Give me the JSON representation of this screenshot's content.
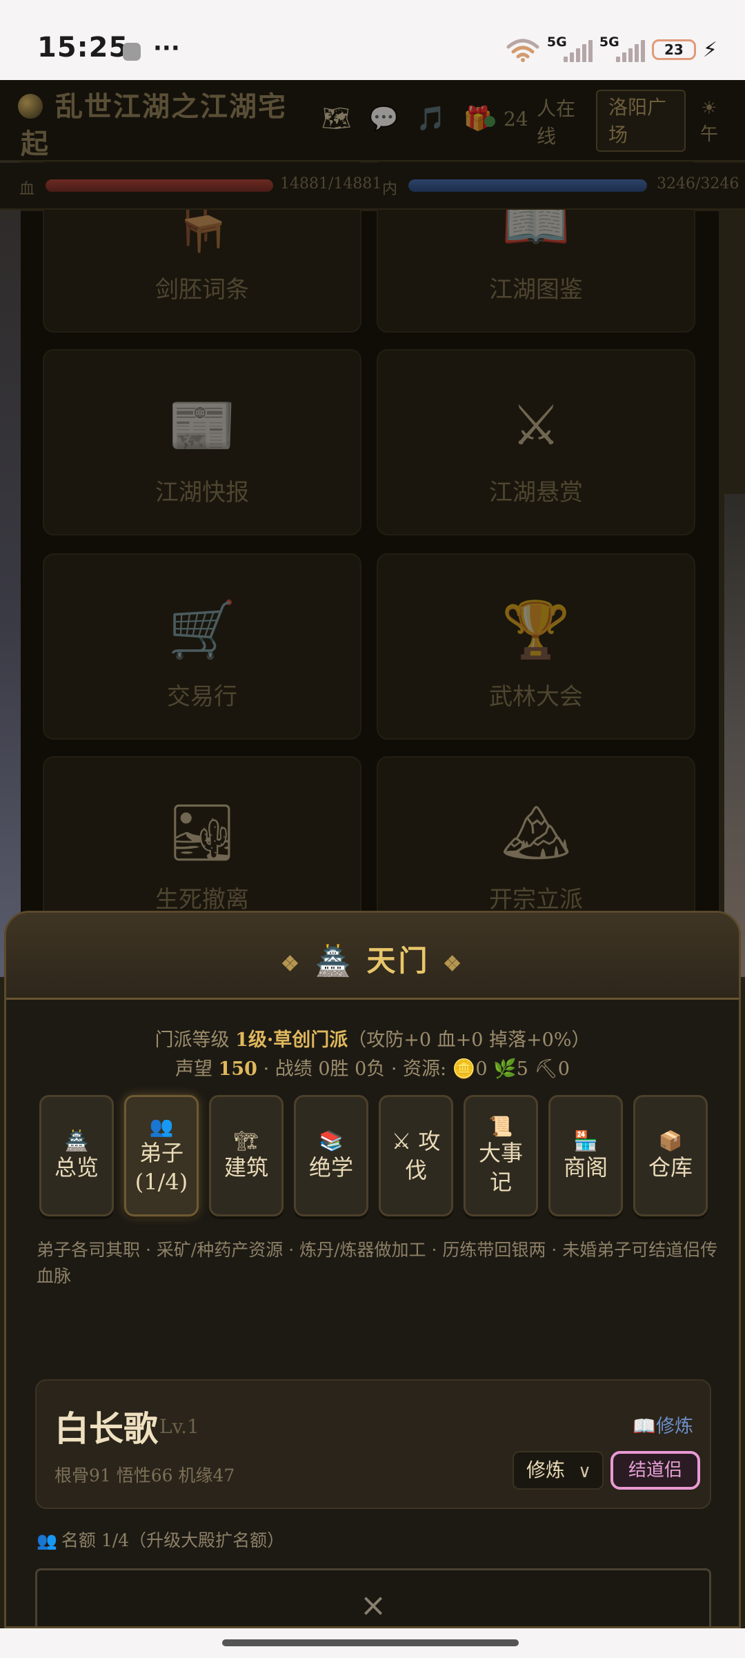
{
  "status_bar": {
    "time": "15:25",
    "more": "···",
    "net1": "5G",
    "net2": "5G",
    "battery": "23"
  },
  "header": {
    "game_title": "乱世江湖之江湖宅起",
    "icons": [
      "map-icon",
      "chat-icon",
      "music-icon",
      "gift-icon"
    ],
    "online_count": "24",
    "online_label": "人在线",
    "location": "洛阳广场",
    "time_of_day": "☀ 午"
  },
  "vitals": {
    "hp_label": "血",
    "hp_value": "14881/14881",
    "hp_fraction": 1.0,
    "mp_label": "内",
    "mp_value": "3246/3246",
    "mp_fraction": 1.0
  },
  "features": [
    {
      "icon": "🪑",
      "label": "剑胚词条"
    },
    {
      "icon": "📖",
      "label": "江湖图鉴"
    },
    {
      "icon": "📰",
      "label": "江湖快报"
    },
    {
      "icon": "⚔",
      "label": "江湖悬赏"
    },
    {
      "icon": "🛒",
      "label": "交易行"
    },
    {
      "icon": "🏆",
      "label": "武林大会"
    },
    {
      "icon": "🏜",
      "label": "生死撤离"
    },
    {
      "icon": "🏔",
      "label": "开宗立派"
    }
  ],
  "sheet": {
    "title_deco": "❖",
    "title_icon": "🏯",
    "title": "天门",
    "info_prefix": "门派等级 ",
    "level_text": "1级·草创门派",
    "info_suffix": "（攻防+0 血+0 掉落+0%）",
    "reputation_prefix": "声望 ",
    "reputation": "150",
    "record_text": " · 战绩 0胜 0负 · 资源: ",
    "res_coin_icon": "🪙",
    "res_coin": "0",
    "res_herb_icon": "🌿",
    "res_herb": "5",
    "res_ore_icon": "⛏",
    "res_ore": "0",
    "tabs": [
      {
        "icon": "🏯",
        "label": "总览"
      },
      {
        "icon": "👥",
        "label": "弟子(1/4)"
      },
      {
        "icon": "🏗",
        "label": "建筑"
      },
      {
        "icon": "📚",
        "label": "绝学"
      },
      {
        "icon": "",
        "label": "⚔ 攻伐"
      },
      {
        "icon": "📜",
        "label": "大事记"
      },
      {
        "icon": "🏪",
        "label": "商阁"
      },
      {
        "icon": "📦",
        "label": "仓库"
      }
    ],
    "tab_description": "弟子各司其职 · 采矿/种药产资源 · 炼丹/炼器做加工 · 历练带回银两 · 未婚弟子可结道侣传血脉",
    "disciple": {
      "name": "白长歌",
      "level": "Lv.1",
      "cultivate_link": "📖修炼",
      "stats": "根骨91 悟性66 机缘47",
      "job_selected": "修炼",
      "marry_button": "结道侣"
    },
    "quota_icon": "👥",
    "quota_text": "名额 1/4（升级大殿扩名额）",
    "recruit_symbol": "×",
    "scroll_hint": "⌄"
  }
}
